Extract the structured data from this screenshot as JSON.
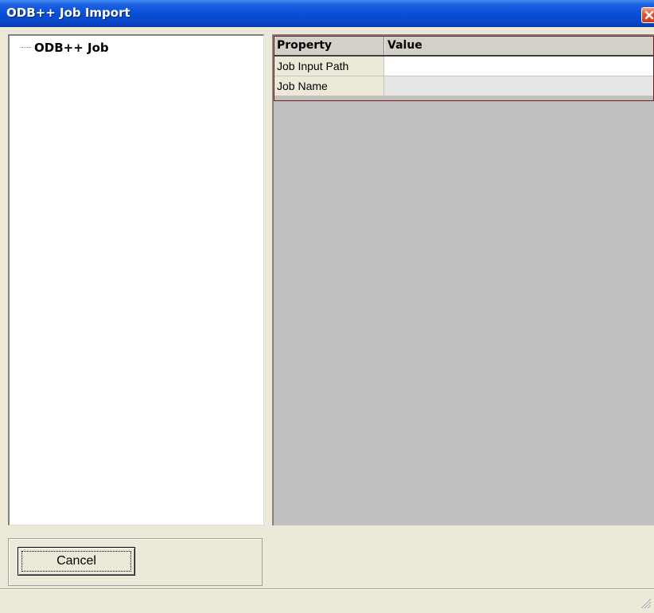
{
  "window": {
    "title": "ODB++ Job Import"
  },
  "tree": {
    "root_label": "ODB++ Job"
  },
  "grid": {
    "columns": [
      "Property",
      "Value"
    ],
    "rows": [
      {
        "property": "Job Input Path",
        "value": ""
      },
      {
        "property": "Job Name",
        "value": ""
      }
    ]
  },
  "buttons": {
    "cancel_label": "Cancel"
  },
  "icons": {
    "close": "close-icon",
    "resize": "resize-grip-icon"
  },
  "colors": {
    "titlebar": "#0a4fd6",
    "close_button": "#e2522e",
    "window_face": "#ece9d8",
    "grid_background": "#c0c0c0"
  }
}
